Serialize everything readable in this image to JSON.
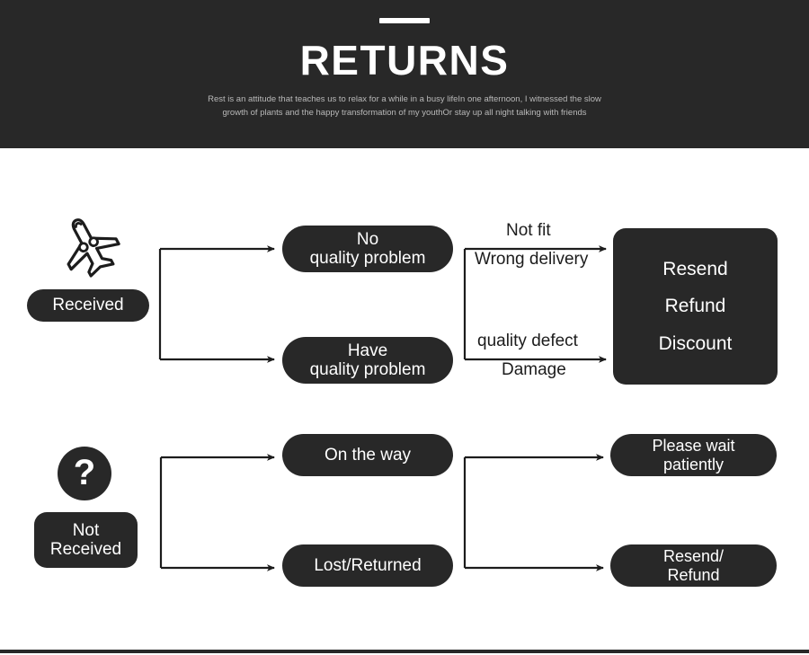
{
  "header": {
    "title": "RETURNS",
    "subtitle": "Rest is an attitude that teaches us to relax for a while in a busy lifeIn one afternoon, I witnessed the slow growth of plants and the happy transformation of my youthOr stay up all night talking with friends",
    "background_color": "#282828",
    "title_color": "#ffffff",
    "subtitle_color": "#b9b9b9"
  },
  "diagram": {
    "flow_received": {
      "icon": "airplane-icon",
      "start_label": "Received",
      "branches": [
        {
          "label_line1": "No",
          "label_line2": "quality problem",
          "edge_label_above": "Not fit",
          "edge_label_below": "Wrong delivery"
        },
        {
          "label_line1": "Have",
          "label_line2": "quality problem",
          "edge_label_above": "quality defect",
          "edge_label_below": "Damage"
        }
      ],
      "resolution": {
        "line1": "Resend",
        "line2": "Refund",
        "line3": "Discount"
      }
    },
    "flow_not_received": {
      "icon": "question-mark-icon",
      "icon_glyph": "?",
      "start_label_line1": "Not",
      "start_label_line2": "Received",
      "branches": [
        {
          "label": "On the way",
          "outcome_line1": "Please wait",
          "outcome_line2": "patiently"
        },
        {
          "label": "Lost/Returned",
          "outcome_line1": "Resend/",
          "outcome_line2": "Refund"
        }
      ]
    },
    "colors": {
      "node_fill": "#282828",
      "node_text": "#ffffff",
      "connector": "#1c1c1c",
      "canvas": "#ffffff"
    }
  }
}
